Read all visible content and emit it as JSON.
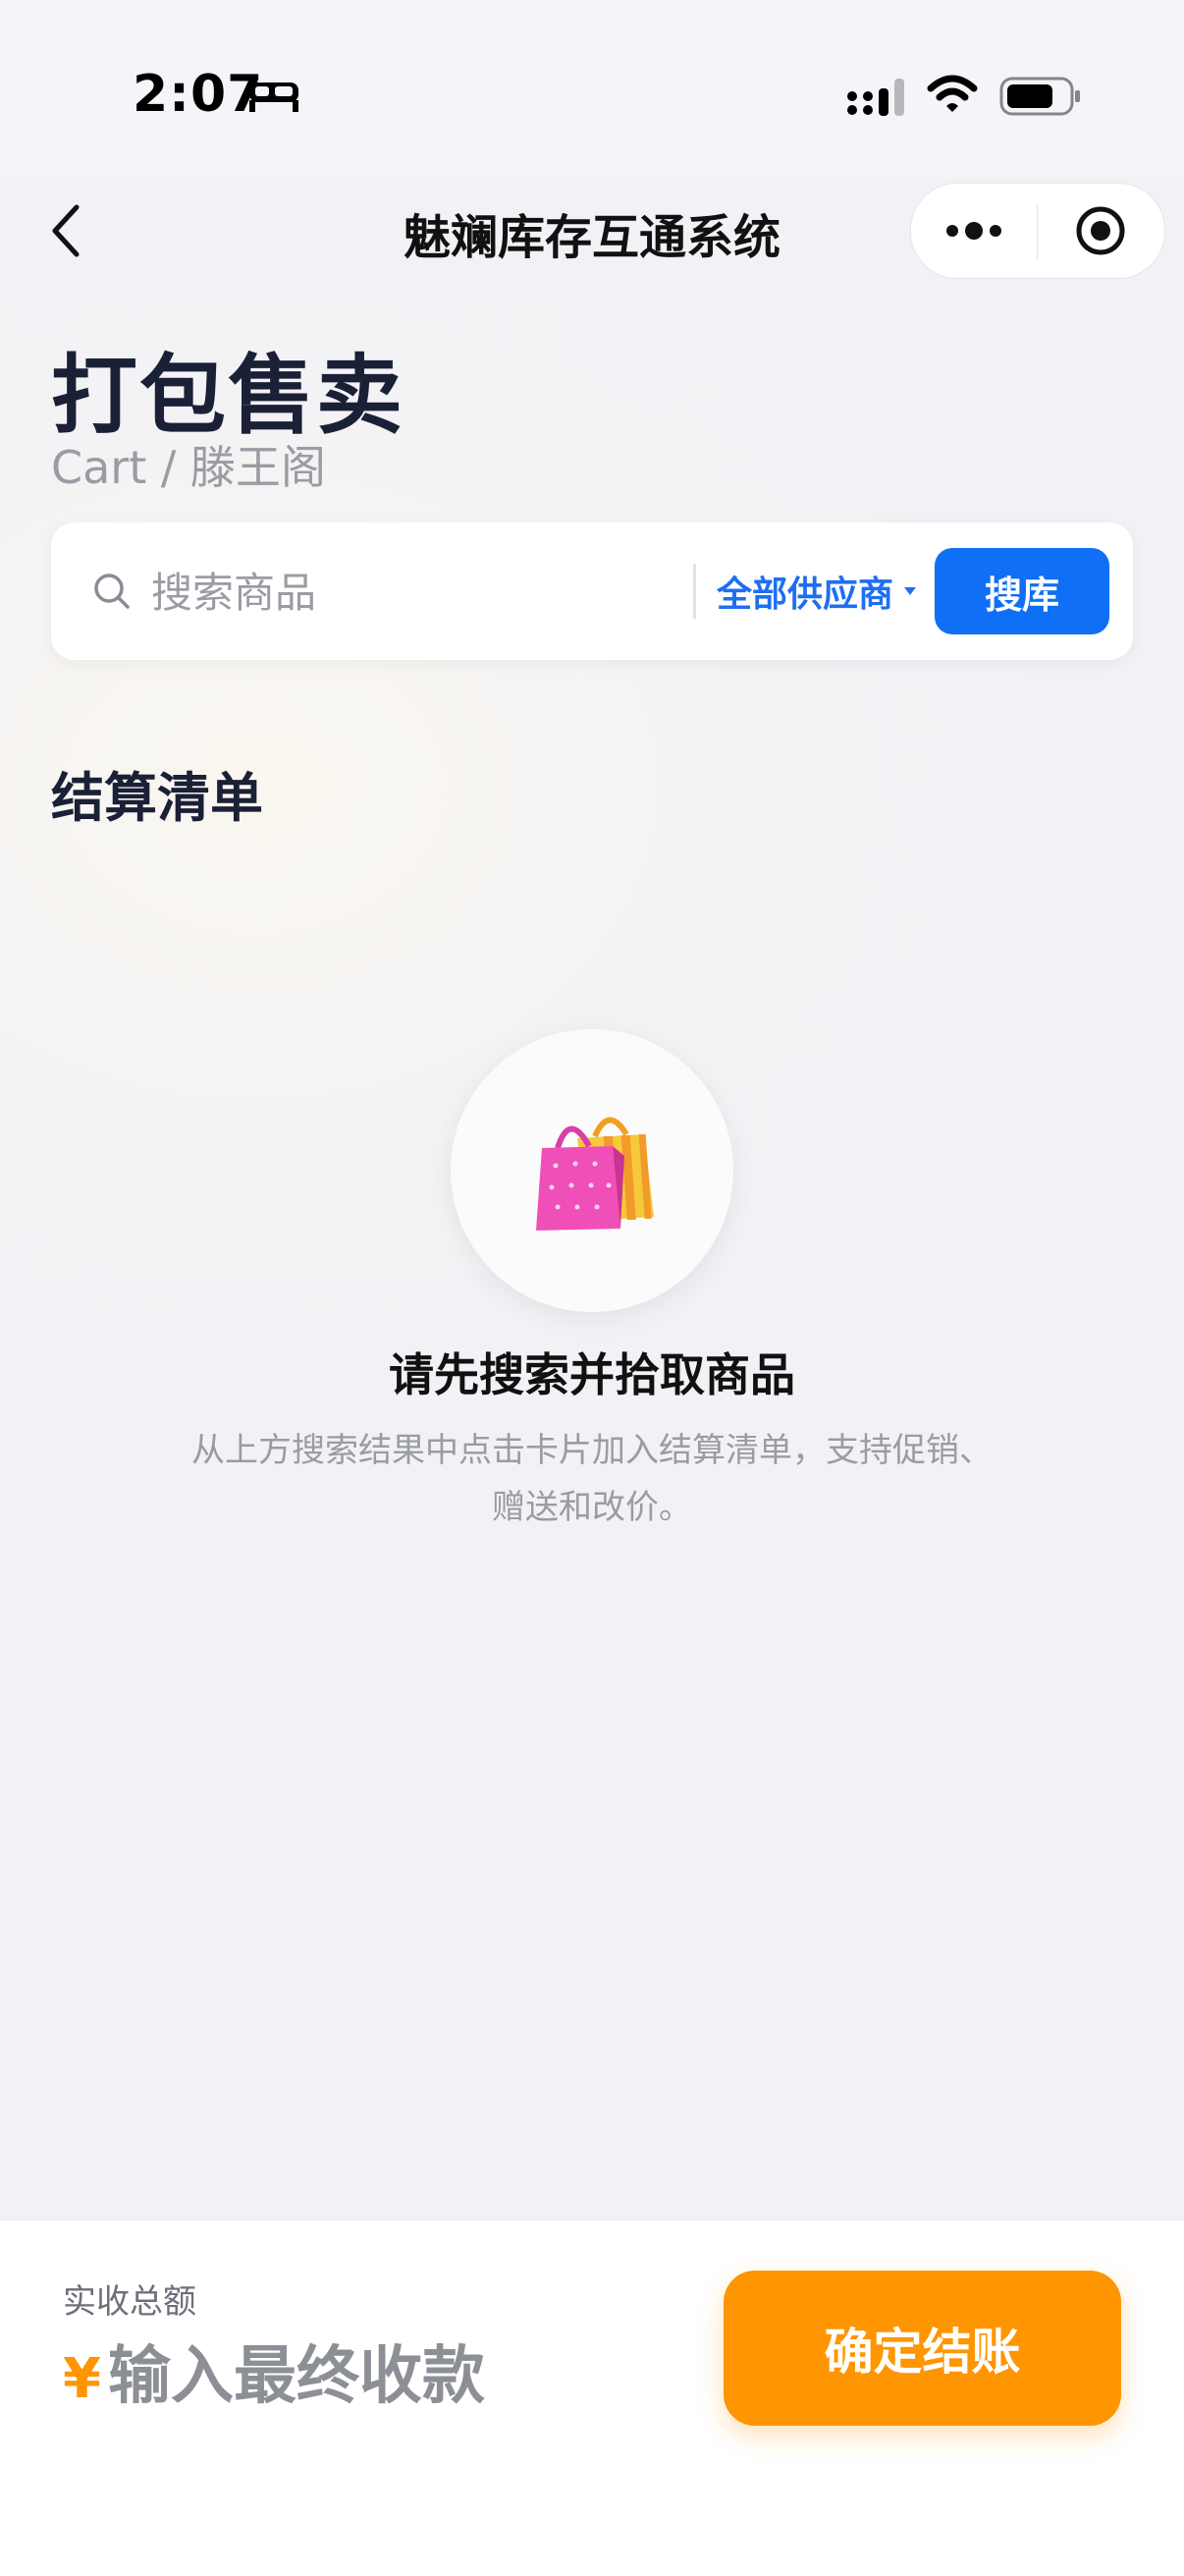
{
  "status_bar": {
    "time": "2:07",
    "icons": [
      "bed-icon",
      "signal-icon",
      "wifi-icon",
      "battery-icon"
    ]
  },
  "nav": {
    "title": "魅斓库存互通系统",
    "back_icon": "chevron-left-icon",
    "capsule_icons": [
      "more-dots-icon",
      "target-icon"
    ]
  },
  "header": {
    "title": "打包售卖",
    "subtitle": "Cart / 滕王阁"
  },
  "search": {
    "placeholder": "搜索商品",
    "value": "",
    "supplier_filter": "全部供应商",
    "button_label": "搜库"
  },
  "cart": {
    "section_title": "结算清单",
    "empty_icon": "shopping-bags-icon",
    "empty_title": "请先搜索并拾取商品",
    "empty_description": "从上方搜索结果中点击卡片加入结算清单，支持促销、赠送和改价。"
  },
  "footer": {
    "total_label": "实收总额",
    "currency": "¥",
    "amount_placeholder": "输入最终收款",
    "amount_value": "",
    "checkout_label": "确定结账"
  },
  "colors": {
    "primary_blue": "#0f6ff6",
    "accent_orange": "#ff9500",
    "heading": "#1a2036"
  }
}
